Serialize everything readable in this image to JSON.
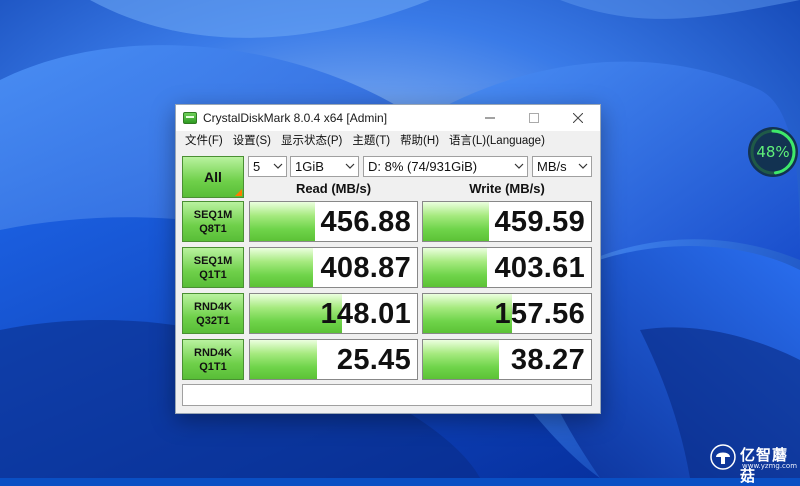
{
  "window": {
    "title": "CrystalDiskMark 8.0.4 x64 [Admin]"
  },
  "menu": [
    {
      "label": "文件(F)"
    },
    {
      "label": "设置(S)"
    },
    {
      "label": "显示状态(P)"
    },
    {
      "label": "主题(T)"
    },
    {
      "label": "帮助(H)"
    },
    {
      "label": "语言(L)(Language)"
    }
  ],
  "controls": {
    "all_label": "All",
    "count": "5",
    "size": "1GiB",
    "drive": "D: 8% (74/931GiB)",
    "unit": "MB/s"
  },
  "headers": {
    "read": "Read (MB/s)",
    "write": "Write (MB/s)"
  },
  "tests": [
    {
      "line1": "SEQ1M",
      "line2": "Q8T1",
      "read": "456.88",
      "write": "459.59",
      "read_fill": 0.39,
      "write_fill": 0.39
    },
    {
      "line1": "SEQ1M",
      "line2": "Q1T1",
      "read": "408.87",
      "write": "403.61",
      "read_fill": 0.38,
      "write_fill": 0.38
    },
    {
      "line1": "RND4K",
      "line2": "Q32T1",
      "read": "148.01",
      "write": "157.56",
      "read_fill": 0.55,
      "write_fill": 0.53
    },
    {
      "line1": "RND4K",
      "line2": "Q1T1",
      "read": "25.45",
      "write": "38.27",
      "read_fill": 0.4,
      "write_fill": 0.45
    }
  ],
  "comment": "",
  "desktop": {
    "gauge_text": "48%",
    "gauge_fraction": 0.48,
    "watermark_text": "亿智蘑菇",
    "watermark_url": "www.yzmg.com",
    "accent_green": "#6fd04a"
  }
}
